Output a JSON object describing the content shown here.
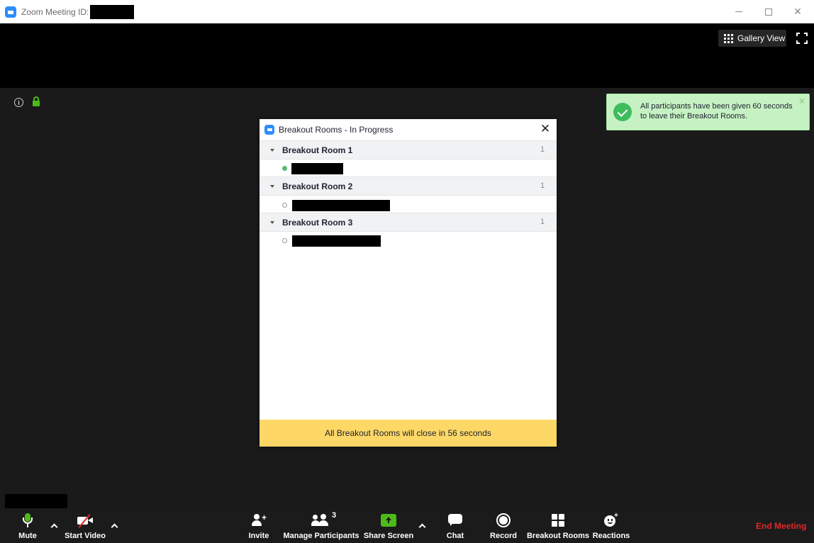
{
  "window": {
    "title": "Zoom Meeting ID:",
    "controls": {
      "minimize": "–",
      "maximize": "□",
      "close": "✕"
    }
  },
  "view": {
    "gallery_label": "Gallery View"
  },
  "notification": {
    "text": "All participants have been given 60 seconds to leave their Breakout Rooms.",
    "close": "✕",
    "color": "#c6f2c3"
  },
  "breakout_dialog": {
    "title": "Breakout Rooms - In Progress",
    "close": "✕",
    "rooms": [
      {
        "name": "Breakout Room 1",
        "count": "1",
        "participant_status": "online"
      },
      {
        "name": "Breakout Room 2",
        "count": "1",
        "participant_status": "offline"
      },
      {
        "name": "Breakout Room 3",
        "count": "1",
        "participant_status": "offline"
      }
    ],
    "footer": "All Breakout Rooms will close in 56 seconds",
    "footer_color": "#fdd866"
  },
  "toolbar": {
    "mute": "Mute",
    "start_video": "Start Video",
    "invite": "Invite",
    "manage_participants": "Manage Participants",
    "participant_count": "3",
    "share_screen": "Share Screen",
    "chat": "Chat",
    "record": "Record",
    "breakout_rooms": "Breakout Rooms",
    "reactions": "Reactions",
    "end_meeting": "End Meeting",
    "end_color": "#e02828",
    "accent": "#4cbb17"
  },
  "icons": [
    "zoom-logo-icon",
    "grid-icon",
    "fullscreen-icon",
    "info-icon",
    "lock-icon",
    "check-icon",
    "caret-down-icon",
    "microphone-icon",
    "video-off-icon",
    "invite-icon",
    "participants-icon",
    "share-screen-icon",
    "chat-icon",
    "record-icon",
    "breakout-rooms-icon",
    "reactions-icon"
  ]
}
